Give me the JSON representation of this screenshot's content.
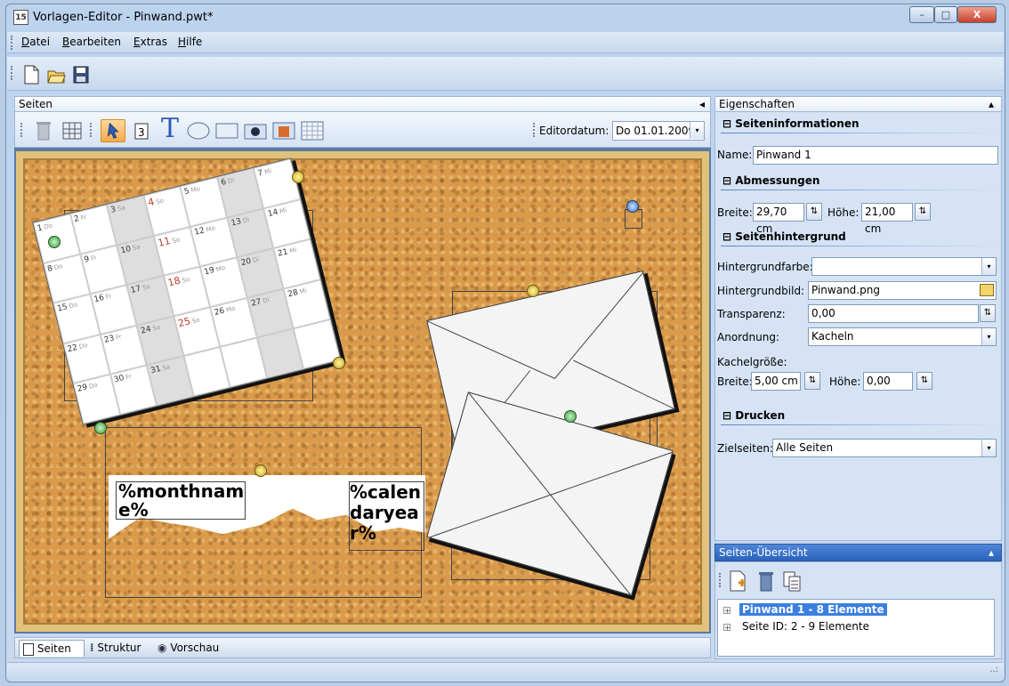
{
  "window": {
    "title": "Vorlagen-Editor - Pinwand.pwt*",
    "app_icon_text": "15",
    "minimize": "–",
    "maximize": "□",
    "close": "X"
  },
  "menu": {
    "items": [
      "Datei",
      "Bearbeiten",
      "Extras",
      "Hilfe"
    ]
  },
  "toolbar": {
    "icons": [
      "new-file-icon",
      "open-folder-icon",
      "save-icon"
    ]
  },
  "pages_pane": {
    "header": "Seiten",
    "collapse_arrow": "◂",
    "tools": [
      "trash-icon",
      "grid-icon",
      "select-arrow-icon",
      "calendar-tool-icon",
      "text-tool-icon",
      "ellipse-tool-icon",
      "rectangle-tool-icon",
      "camera-tool-icon",
      "image-tool-icon",
      "month-grid-tool-icon"
    ],
    "text_tool_glyph": "T",
    "editordate_label": "Editordatum:",
    "editordate_value": "Do 01.01.2009",
    "dropdown_arrow": "▾"
  },
  "canvas": {
    "calendar_days": [
      {
        "n": "1",
        "w": "Do"
      },
      {
        "n": "2",
        "w": "Fr"
      },
      {
        "n": "3",
        "w": "Sa"
      },
      {
        "n": "4",
        "w": "So",
        "red": true
      },
      {
        "n": "5",
        "w": "Mo"
      },
      {
        "n": "6",
        "w": "Di"
      },
      {
        "n": "7",
        "w": "Mi"
      },
      {
        "n": "8",
        "w": "Do"
      },
      {
        "n": "9",
        "w": "Fr"
      },
      {
        "n": "10",
        "w": "Sa"
      },
      {
        "n": "11",
        "w": "So",
        "red": true
      },
      {
        "n": "12",
        "w": "Mo"
      },
      {
        "n": "13",
        "w": "Di"
      },
      {
        "n": "14",
        "w": "Mi"
      },
      {
        "n": "15",
        "w": "Do"
      },
      {
        "n": "16",
        "w": "Fr"
      },
      {
        "n": "17",
        "w": "Sa"
      },
      {
        "n": "18",
        "w": "So",
        "red": true
      },
      {
        "n": "19",
        "w": "Mo"
      },
      {
        "n": "20",
        "w": "Di"
      },
      {
        "n": "21",
        "w": "Mi"
      },
      {
        "n": "22",
        "w": "Do"
      },
      {
        "n": "23",
        "w": "Fr"
      },
      {
        "n": "24",
        "w": "Sa"
      },
      {
        "n": "25",
        "w": "So",
        "red": true
      },
      {
        "n": "26",
        "w": "Mo"
      },
      {
        "n": "27",
        "w": "Di"
      },
      {
        "n": "28",
        "w": "Mi"
      },
      {
        "n": "29",
        "w": "Do"
      },
      {
        "n": "30",
        "w": "Fr"
      },
      {
        "n": "31",
        "w": "Sa"
      },
      {
        "n": "",
        "w": ""
      },
      {
        "n": "",
        "w": ""
      },
      {
        "n": "",
        "w": ""
      },
      {
        "n": "",
        "w": ""
      }
    ],
    "monthname_placeholder": "%monthname%",
    "calendaryear_placeholder": "%calendaryear%"
  },
  "bottom_tabs": [
    "Seiten",
    "Struktur",
    "Vorschau"
  ],
  "properties": {
    "header": "Eigenschaften",
    "collapse_arrow": "▴",
    "section_info": "Seiteninformationen",
    "name_label": "Name:",
    "name_value": "Pinwand 1",
    "section_dimensions": "Abmessungen",
    "width_label": "Breite:",
    "width_value": "29,70 cm",
    "height_label": "Höhe:",
    "height_value": "21,00 cm",
    "section_background": "Seitenhintergrund",
    "bgcolor_label": "Hintergrundfarbe:",
    "bgcolor_value": "",
    "bgimage_label": "Hintergrundbild:",
    "bgimage_value": "Pinwand.png",
    "transparency_label": "Transparenz:",
    "transparency_value": "0,00",
    "arrangement_label": "Anordnung:",
    "arrangement_value": "Kacheln",
    "tilesize_label": "Kachelgröße:",
    "tile_width_label": "Breite:",
    "tile_width_value": "5,00 cm",
    "tile_height_label": "Höhe:",
    "tile_height_value": "0,00",
    "section_print": "Drucken",
    "target_pages_label": "Zielseiten:",
    "target_pages_value": "Alle Seiten",
    "section_toggle": "⊟"
  },
  "overview": {
    "header": "Seiten-Übersicht",
    "collapse_arrow": "▴",
    "tools": [
      "add-page-icon",
      "delete-page-icon",
      "copy-page-icon"
    ],
    "tree": [
      {
        "label": "Pinwand 1 - 8 Elemente",
        "selected": true
      },
      {
        "label": "Seite ID: 2 - 9 Elemente",
        "selected": false
      }
    ],
    "expander": "+"
  },
  "status": {
    "grip": "..:"
  },
  "colors": {
    "accent": "#2b63bd",
    "cork": "#d99a4b",
    "frame": "#e2c27a",
    "select_tool": "#f7a94b"
  }
}
